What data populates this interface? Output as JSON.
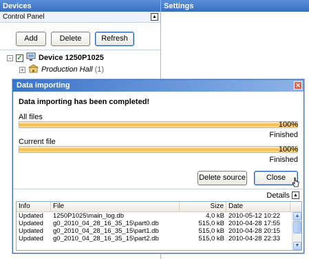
{
  "devices_panel": {
    "title": "Devices",
    "control_panel_label": "Control Panel",
    "add_label": "Add",
    "delete_label": "Delete",
    "refresh_label": "Refresh",
    "tree": {
      "device_label": "Device 1250P1025",
      "hall_label": "Production Hall",
      "hall_count": "(1)"
    }
  },
  "settings_panel": {
    "title": "Settings"
  },
  "dialog": {
    "title": "Data importing",
    "message": "Data importing has been completed!",
    "all_files": {
      "label": "All files",
      "progress": 1.0,
      "percent": "100%",
      "status": "Finished"
    },
    "current_file": {
      "label": "Current file",
      "progress": 1.0,
      "percent": "100%",
      "status": "Finished"
    },
    "delete_source_label": "Delete source",
    "close_label": "Close",
    "details_label": "Details",
    "table": {
      "columns": [
        "Info",
        "File",
        "Size",
        "Date"
      ],
      "rows": [
        [
          "Updated",
          "1250P1025\\main_log.db",
          "4,0 kB",
          "2010-05-12 10:22"
        ],
        [
          "Updated",
          "g0_2010_04_28_16_35_15\\part0.db",
          "515,0 kB",
          "2010-04-28 17:55"
        ],
        [
          "Updated",
          "g0_2010_04_28_16_35_15\\part1.db",
          "515,0 kB",
          "2010-04-28 20:15"
        ],
        [
          "Updated",
          "g0_2010_04_28_16_35_15\\part2.db",
          "515,0 kB",
          "2010-04-28 22:33"
        ]
      ]
    }
  },
  "colors": {
    "header_blue": "#3a6fc0",
    "progress_orange": "#f5b742",
    "check_green": "#21a121"
  }
}
